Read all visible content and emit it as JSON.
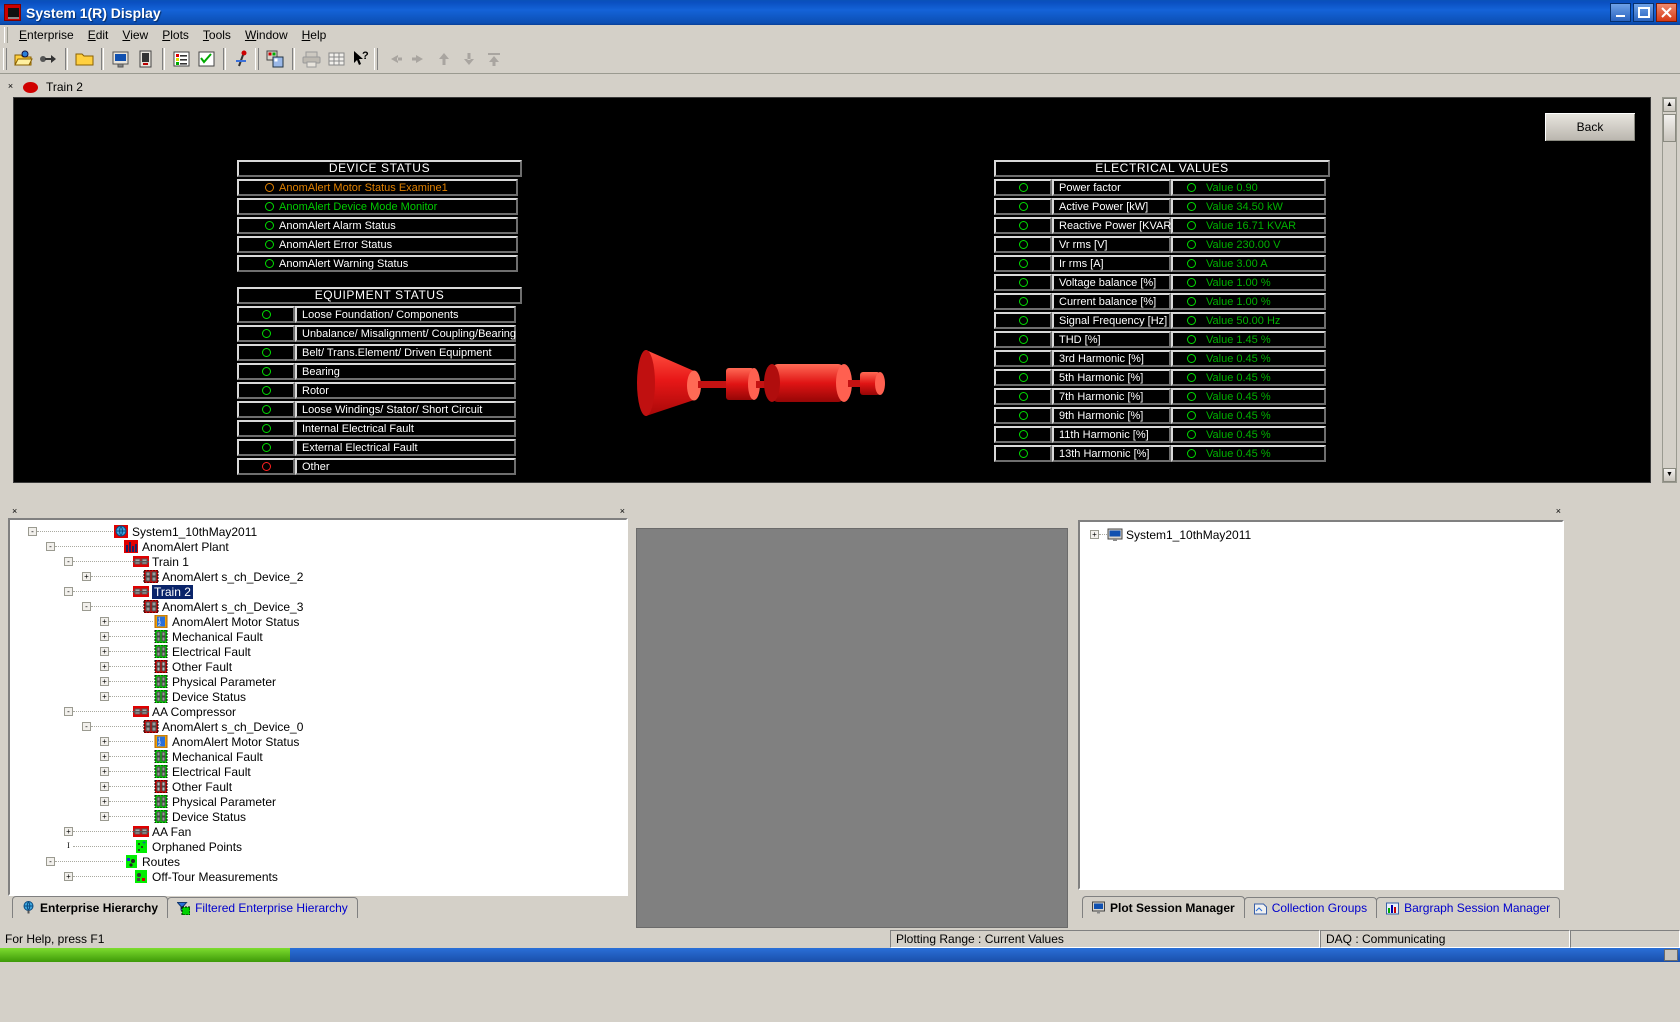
{
  "window": {
    "title": "System 1(R) Display",
    "app_icon": "monitor-icon",
    "minimize": "_",
    "maximize": "❐",
    "close": "✕"
  },
  "menubar": {
    "items": [
      {
        "label": "Enterprise",
        "accel": "n"
      },
      {
        "label": "Edit",
        "accel": "E"
      },
      {
        "label": "View",
        "accel": "V"
      },
      {
        "label": "Plots",
        "accel": "P"
      },
      {
        "label": "Tools",
        "accel": "T"
      },
      {
        "label": "Window",
        "accel": "W"
      },
      {
        "label": "Help",
        "accel": "H"
      }
    ]
  },
  "toolbar": {
    "icons": [
      "open-folder-icon",
      "connect-arrow-icon",
      "folder-icon",
      "display-monitor-icon",
      "device-list-icon",
      "properties-list-icon",
      "checklist-icon",
      "trend-point-icon",
      "copy-panels-icon",
      "print-icon",
      "grid-icon",
      "help-pointer-icon",
      "nav-back-icon",
      "nav-forward-icon",
      "nav-up-icon",
      "nav-down-icon",
      "nav-top-icon"
    ]
  },
  "document": {
    "close_glyph": "×",
    "status_indicator": "red-ellipse-alarm",
    "title": "Train 2",
    "back_button": "Back",
    "motor_graphic": "red-3d-motor-assembly"
  },
  "device_status": {
    "title": "DEVICE STATUS",
    "rows": [
      {
        "led": "amber",
        "label": "AnomAlert Motor Status Examine1",
        "color": "#e08000"
      },
      {
        "led": "green",
        "label": "AnomAlert Device Mode Monitor",
        "color": "#00cc00"
      },
      {
        "led": "green",
        "label": "AnomAlert Alarm Status",
        "color": "#ffffff"
      },
      {
        "led": "green",
        "label": "AnomAlert Error Status",
        "color": "#ffffff"
      },
      {
        "led": "green",
        "label": "AnomAlert Warning Status",
        "color": "#ffffff"
      }
    ]
  },
  "equipment_status": {
    "title": "EQUIPMENT STATUS",
    "rows": [
      {
        "led": "green",
        "label": "Loose Foundation/ Components"
      },
      {
        "led": "green",
        "label": "Unbalance/ Misalignment/ Coupling/Bearing"
      },
      {
        "led": "green",
        "label": "Belt/ Trans.Element/ Driven Equipment"
      },
      {
        "led": "green",
        "label": "Bearing"
      },
      {
        "led": "green",
        "label": "Rotor"
      },
      {
        "led": "green",
        "label": "Loose Windings/ Stator/ Short Circuit"
      },
      {
        "led": "green",
        "label": "Internal Electrical Fault"
      },
      {
        "led": "green",
        "label": "External Electrical Fault"
      },
      {
        "led": "red",
        "label": "Other"
      }
    ]
  },
  "electrical_values": {
    "title": "ELECTRICAL VALUES",
    "rows": [
      {
        "led": "green",
        "label": "Power factor",
        "value_led": "green",
        "value": "Value 0.90"
      },
      {
        "led": "green",
        "label": "Active Power [kW]",
        "value_led": "green",
        "value": "Value 34.50 kW"
      },
      {
        "led": "green",
        "label": "Reactive Power [KVAR]",
        "value_led": "green",
        "value": "Value 16.71 KVAR"
      },
      {
        "led": "green",
        "label": "Vr rms [V]",
        "value_led": "green",
        "value": "Value 230.00 V"
      },
      {
        "led": "green",
        "label": "Ir rms [A]",
        "value_led": "green",
        "value": "Value 3.00 A"
      },
      {
        "led": "green",
        "label": "Voltage balance [%]",
        "value_led": "green",
        "value": "Value 1.00 %"
      },
      {
        "led": "green",
        "label": "Current balance [%]",
        "value_led": "green",
        "value": "Value 1.00 %"
      },
      {
        "led": "green",
        "label": "Signal Frequency [Hz]",
        "value_led": "green",
        "value": "Value 50.00 Hz"
      },
      {
        "led": "green",
        "label": "THD [%]",
        "value_led": "green",
        "value": "Value 1.45 %"
      },
      {
        "led": "green",
        "label": "3rd Harmonic [%]",
        "value_led": "green",
        "value": "Value 0.45 %"
      },
      {
        "led": "green",
        "label": "5th Harmonic [%]",
        "value_led": "green",
        "value": "Value 0.45 %"
      },
      {
        "led": "green",
        "label": "7th Harmonic [%]",
        "value_led": "green",
        "value": "Value 0.45 %"
      },
      {
        "led": "green",
        "label": "9th Harmonic [%]",
        "value_led": "green",
        "value": "Value 0.45 %"
      },
      {
        "led": "green",
        "label": "11th Harmonic [%]",
        "value_led": "green",
        "value": "Value 0.45 %"
      },
      {
        "led": "green",
        "label": "13th Harmonic [%]",
        "value_led": "green",
        "value": "Value 0.45 %"
      }
    ]
  },
  "tree": {
    "close_glyph": "×",
    "nodes": [
      {
        "depth": 0,
        "toggle": "-",
        "icon": "globe-icon",
        "label": "System1_10thMay2011",
        "selected": false
      },
      {
        "depth": 1,
        "toggle": "-",
        "icon": "plant-chart-icon",
        "label": "AnomAlert Plant",
        "selected": false
      },
      {
        "depth": 2,
        "toggle": "-",
        "icon": "train-icon",
        "label": "Train 1",
        "selected": false
      },
      {
        "depth": 3,
        "toggle": "+",
        "icon": "device-red-icon",
        "label": "AnomAlert s_ch_Device_2",
        "selected": false
      },
      {
        "depth": 2,
        "toggle": "-",
        "icon": "train-icon",
        "label": "Train 2",
        "selected": true
      },
      {
        "depth": 3,
        "toggle": "-",
        "icon": "device-red-icon",
        "label": "AnomAlert s_ch_Device_3",
        "selected": false
      },
      {
        "depth": 4,
        "toggle": "+",
        "icon": "motor-status-icon",
        "label": "AnomAlert Motor Status",
        "selected": false
      },
      {
        "depth": 4,
        "toggle": "+",
        "icon": "point-green-icon",
        "label": "Mechanical Fault",
        "selected": false
      },
      {
        "depth": 4,
        "toggle": "+",
        "icon": "point-green-icon",
        "label": "Electrical Fault",
        "selected": false
      },
      {
        "depth": 4,
        "toggle": "+",
        "icon": "point-red-icon",
        "label": "Other Fault",
        "selected": false
      },
      {
        "depth": 4,
        "toggle": "+",
        "icon": "point-green-icon",
        "label": "Physical Parameter",
        "selected": false
      },
      {
        "depth": 4,
        "toggle": "+",
        "icon": "point-green-icon",
        "label": "Device Status",
        "selected": false
      },
      {
        "depth": 2,
        "toggle": "-",
        "icon": "train-icon",
        "label": "AA Compressor",
        "selected": false
      },
      {
        "depth": 3,
        "toggle": "-",
        "icon": "device-red-icon",
        "label": "AnomAlert s_ch_Device_0",
        "selected": false
      },
      {
        "depth": 4,
        "toggle": "+",
        "icon": "motor-status-icon",
        "label": "AnomAlert Motor Status",
        "selected": false
      },
      {
        "depth": 4,
        "toggle": "+",
        "icon": "point-green-icon",
        "label": "Mechanical Fault",
        "selected": false
      },
      {
        "depth": 4,
        "toggle": "+",
        "icon": "point-green-icon",
        "label": "Electrical Fault",
        "selected": false
      },
      {
        "depth": 4,
        "toggle": "+",
        "icon": "point-red-icon",
        "label": "Other Fault",
        "selected": false
      },
      {
        "depth": 4,
        "toggle": "+",
        "icon": "point-green-icon",
        "label": "Physical Parameter",
        "selected": false
      },
      {
        "depth": 4,
        "toggle": "+",
        "icon": "point-green-icon",
        "label": "Device Status",
        "selected": false
      },
      {
        "depth": 2,
        "toggle": "+",
        "icon": "train-icon",
        "label": "AA Fan",
        "selected": false
      },
      {
        "depth": 2,
        "toggle": "I",
        "icon": "orphaned-icon",
        "label": "Orphaned Points",
        "selected": false
      },
      {
        "depth": 1,
        "toggle": "-",
        "icon": "routes-icon",
        "label": "Routes",
        "selected": false
      },
      {
        "depth": 2,
        "toggle": "+",
        "icon": "offtour-icon",
        "label": "Off-Tour Measurements",
        "selected": false
      }
    ]
  },
  "left_tabs": [
    {
      "label": "Enterprise Hierarchy",
      "icon": "globe-icon",
      "active": true
    },
    {
      "label": "Filtered Enterprise Hierarchy",
      "icon": "filter-icon",
      "active": false
    }
  ],
  "right_pane": {
    "close_glyph": "×",
    "tree": [
      {
        "toggle": "+",
        "icon": "monitor-small-icon",
        "label": "System1_10thMay2011"
      }
    ]
  },
  "right_tabs": [
    {
      "label": "Plot Session Manager",
      "icon": "plot-session-icon",
      "active": true
    },
    {
      "label": "Collection Groups",
      "icon": "collection-group-icon",
      "active": false
    },
    {
      "label": "Bargraph Session Manager",
      "icon": "bargraph-icon",
      "active": false
    }
  ],
  "statusbar": {
    "help_text": "For Help, press F1",
    "plotting_range": "Plotting Range : Current Values",
    "daq": "DAQ : Communicating",
    "progress_indicator": "green-activity-bar"
  },
  "colors": {
    "titlebar_blue": "#0a52b8",
    "canvas_black": "#000000",
    "led_green": "#00dd00",
    "led_amber": "#e08000",
    "led_red": "#ff2020",
    "value_green": "#00b000",
    "selection_blue": "#0a246a",
    "chrome_gray": "#d4d0c8",
    "motor_red": "#e01010"
  }
}
